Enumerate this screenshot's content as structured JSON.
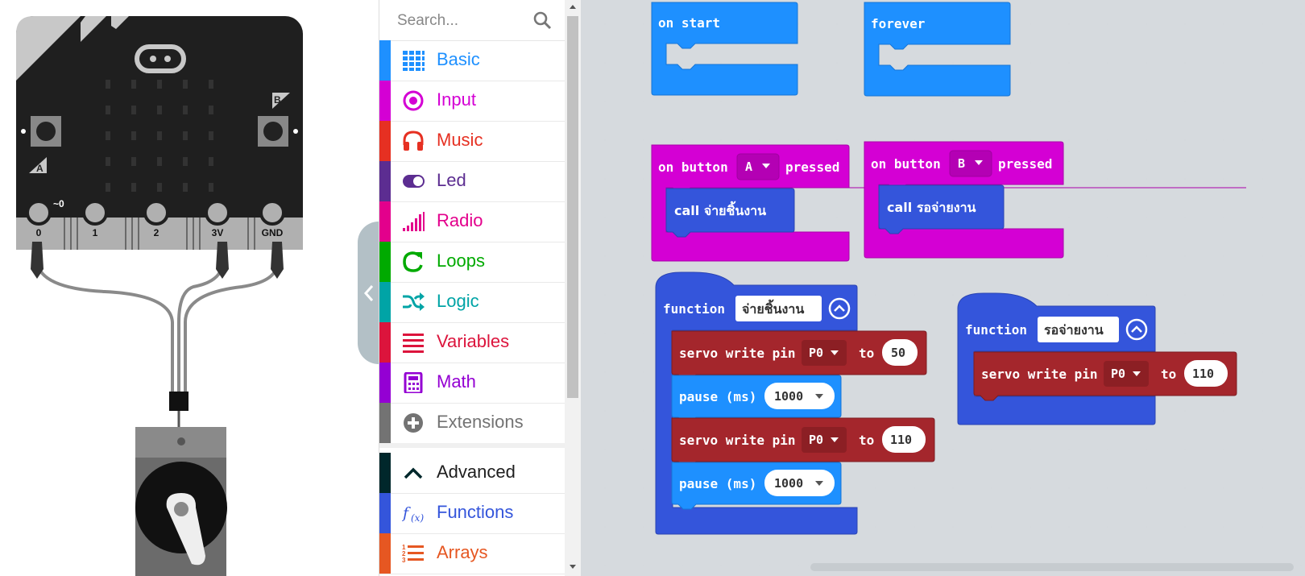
{
  "simulator": {
    "pins": [
      "0",
      "1",
      "2",
      "3V",
      "GND"
    ],
    "pin0_extra": "~0",
    "button_a": "A",
    "button_b": "B"
  },
  "toolbox": {
    "search_placeholder": "Search...",
    "categories": [
      {
        "label": "Basic",
        "color": "#1e90ff",
        "icon": "grid-icon"
      },
      {
        "label": "Input",
        "color": "#d400d4",
        "icon": "radio-circle-icon"
      },
      {
        "label": "Music",
        "color": "#e63022",
        "icon": "headphones-icon"
      },
      {
        "label": "Led",
        "color": "#5c2d91",
        "icon": "toggle-icon"
      },
      {
        "label": "Radio",
        "color": "#e3008c",
        "icon": "signal-bars-icon"
      },
      {
        "label": "Loops",
        "color": "#00aa00",
        "icon": "refresh-icon"
      },
      {
        "label": "Logic",
        "color": "#00a4a6",
        "icon": "shuffle-icon"
      },
      {
        "label": "Variables",
        "color": "#dc143c",
        "icon": "list-lines-icon"
      },
      {
        "label": "Math",
        "color": "#9400d3",
        "icon": "calculator-icon"
      },
      {
        "label": "Extensions",
        "color": "#737373",
        "icon": "plus-circle-icon"
      },
      {
        "label": "Advanced",
        "color": "#00272b",
        "icon": "chevron-up-icon"
      },
      {
        "label": "Functions",
        "color": "#3455db",
        "icon": "function-icon"
      },
      {
        "label": "Arrays",
        "color": "#e65722",
        "icon": "numbered-list-icon"
      }
    ]
  },
  "workspace": {
    "on_start": "on start",
    "forever": "forever",
    "button_a_block": {
      "prefix": "on button",
      "button": "A",
      "suffix": "pressed",
      "call": "call จ่ายชิ้นงาน"
    },
    "button_b_block": {
      "prefix": "on button",
      "button": "B",
      "suffix": "pressed",
      "call": "call รอจ่ายงาน"
    },
    "function1": {
      "keyword": "function",
      "name": "จ่ายชิ้นงาน",
      "servo1": {
        "label": "servo write pin",
        "pin": "P0",
        "to": "to",
        "value": "50"
      },
      "pause1": {
        "label": "pause (ms)",
        "value": "1000"
      },
      "servo2": {
        "label": "servo write pin",
        "pin": "P0",
        "to": "to",
        "value": "110"
      },
      "pause2": {
        "label": "pause (ms)",
        "value": "1000"
      }
    },
    "function2": {
      "keyword": "function",
      "name": "รอจ่ายงาน",
      "servo1": {
        "label": "servo write pin",
        "pin": "P0",
        "to": "to",
        "value": "110"
      }
    },
    "colors": {
      "basic": "#1e90ff",
      "input": "#d400d4",
      "functions": "#3455db",
      "servo": "#a4262c"
    }
  }
}
